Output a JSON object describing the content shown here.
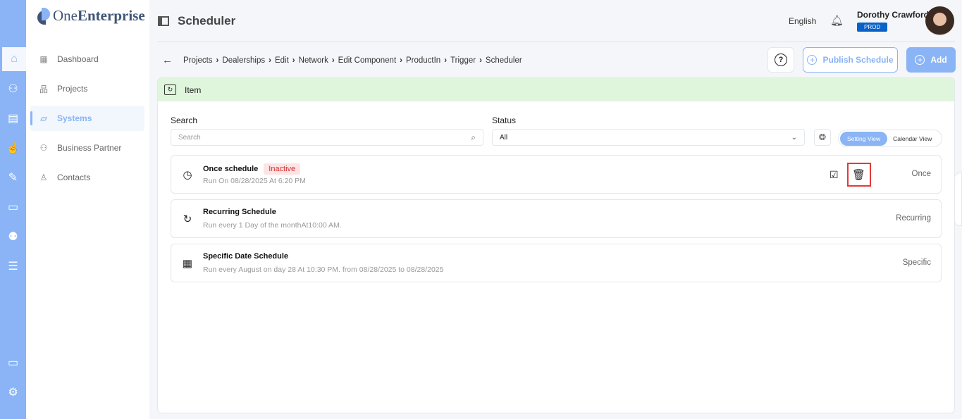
{
  "brand": {
    "name_light": "One",
    "name_bold": "Enterprise"
  },
  "rail": [
    "home-icon",
    "users-icon",
    "store-icon",
    "touch-icon",
    "tools-icon",
    "monitor-chart-icon",
    "people-icon",
    "server-icon",
    "monitor-grid-icon",
    "gear-icon"
  ],
  "sidebar": {
    "items": [
      {
        "label": "Dashboard"
      },
      {
        "label": "Projects"
      },
      {
        "label": "Systems",
        "active": true
      },
      {
        "label": "Business Partner"
      },
      {
        "label": "Contacts"
      }
    ]
  },
  "header": {
    "title": "Scheduler",
    "language": "English",
    "user": "Dorothy Crawford",
    "env": "PROD"
  },
  "breadcrumb": [
    "Projects",
    "Dealerships",
    "Edit",
    "Network",
    "Edit Component",
    "ProductIn",
    "Trigger",
    "Scheduler"
  ],
  "actions": {
    "help": "?",
    "publish": "Publish Schedule",
    "add": "Add"
  },
  "card": {
    "title": "Item"
  },
  "filters": {
    "search_label": "Search",
    "search_placeholder": "Search",
    "status_label": "Status",
    "status_value": "All",
    "views": [
      "Setting View",
      "Calendar View"
    ]
  },
  "schedules": [
    {
      "title": "Once schedule",
      "badge": "Inactive",
      "desc": "Run On 08/28/2025 At 6:20 PM",
      "kind": "Once"
    },
    {
      "title": "Recurring Schedule",
      "desc": "Run every 1 Day of the monthAt10:00 AM.",
      "kind": "Recurring"
    },
    {
      "title": "Specific Date Schedule",
      "desc": "Run every August on day 28 At 10:30 PM. from 08/28/2025 to 08/28/2025",
      "kind": "Specific"
    }
  ],
  "colors": {
    "accent": "#8ab4f5",
    "header_green": "#dff5dc",
    "danger": "#e53935",
    "prod": "#0a62c8"
  }
}
